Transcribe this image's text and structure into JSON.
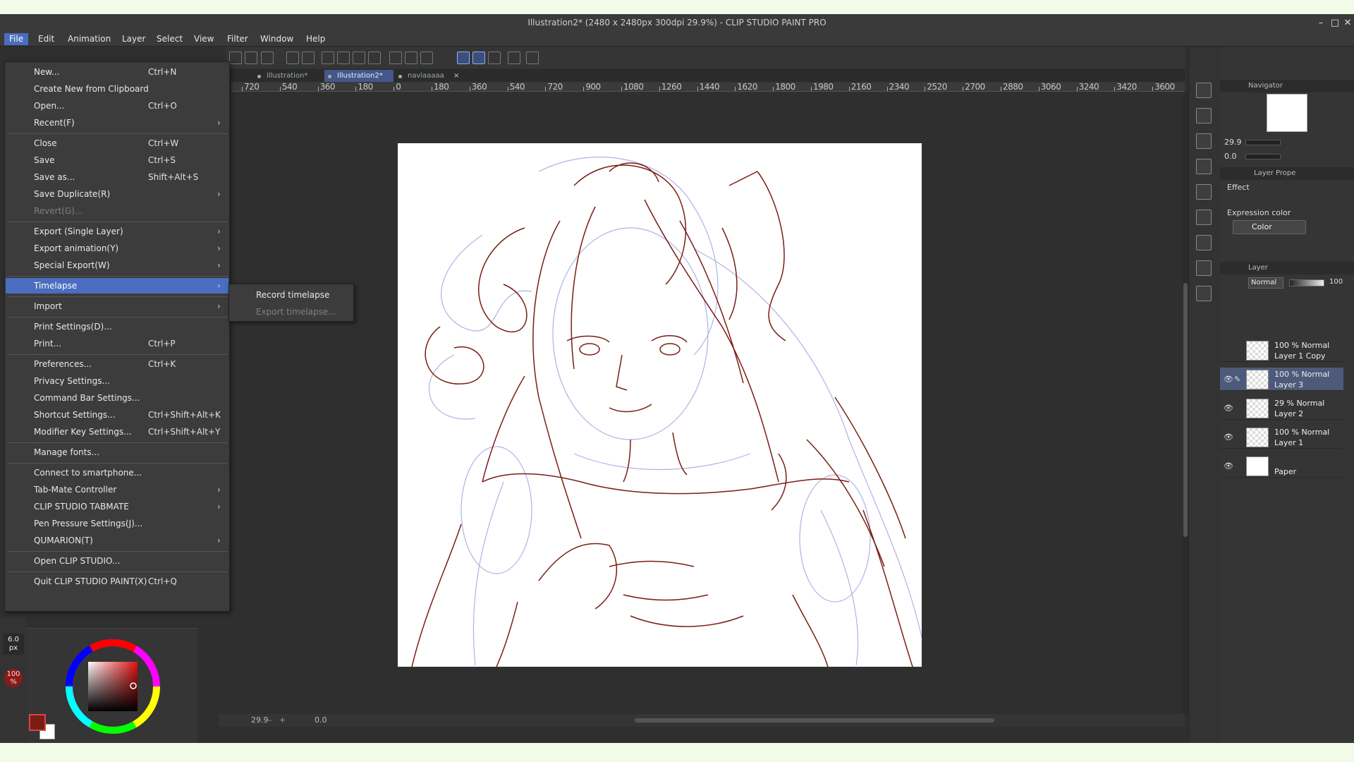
{
  "window": {
    "title": "Illustration2* (2480 x 2480px 300dpi 29.9%) - CLIP STUDIO PAINT PRO",
    "controls": {
      "minimize": "–",
      "maximize": "□",
      "close": "✕"
    }
  },
  "menubar": [
    "File",
    "Edit",
    "Animation",
    "Layer",
    "Select",
    "View",
    "Filter",
    "Window",
    "Help"
  ],
  "tabs": [
    {
      "label": "Illustration*"
    },
    {
      "label": "Illustration2*"
    },
    {
      "label": "naviaaaaa",
      "close": "×"
    }
  ],
  "ruler_labels": [
    "720",
    "540",
    "360",
    "180",
    "0",
    "180",
    "360",
    "540",
    "720",
    "900",
    "1080",
    "1260",
    "1440",
    "1620",
    "1800",
    "1980",
    "2160",
    "2340",
    "2520",
    "2700",
    "2880",
    "3060",
    "3240",
    "3420",
    "3600"
  ],
  "file_menu": [
    {
      "label": "New...",
      "shortcut": "Ctrl+N"
    },
    {
      "label": "Create New from Clipboard",
      "shortcut": ""
    },
    {
      "label": "Open...",
      "shortcut": "Ctrl+O"
    },
    {
      "label": "Recent(F)",
      "submenu": true
    },
    {
      "label": "Close",
      "shortcut": "Ctrl+W"
    },
    {
      "label": "Save",
      "shortcut": "Ctrl+S"
    },
    {
      "label": "Save as...",
      "shortcut": "Shift+Alt+S"
    },
    {
      "label": "Save Duplicate(R)",
      "submenu": true
    },
    {
      "label": "Revert(G)...",
      "disabled": true
    },
    {
      "label": "Export (Single Layer)",
      "submenu": true
    },
    {
      "label": "Export animation(Y)",
      "submenu": true
    },
    {
      "label": "Special Export(W)",
      "submenu": true
    },
    {
      "label": "Timelapse",
      "submenu": true,
      "highlighted": true
    },
    {
      "label": "Import",
      "submenu": true
    },
    {
      "label": "Print Settings(D)...",
      "shortcut": ""
    },
    {
      "label": "Print...",
      "shortcut": "Ctrl+P"
    },
    {
      "label": "Preferences...",
      "shortcut": "Ctrl+K"
    },
    {
      "label": "Privacy Settings...",
      "shortcut": ""
    },
    {
      "label": "Command Bar Settings...",
      "shortcut": ""
    },
    {
      "label": "Shortcut Settings...",
      "shortcut": "Ctrl+Shift+Alt+K"
    },
    {
      "label": "Modifier Key Settings...",
      "shortcut": "Ctrl+Shift+Alt+Y"
    },
    {
      "label": "Manage fonts...",
      "shortcut": ""
    },
    {
      "label": "Connect to smartphone...",
      "shortcut": ""
    },
    {
      "label": "Tab-Mate Controller",
      "submenu": true
    },
    {
      "label": "CLIP STUDIO TABMATE",
      "submenu": true
    },
    {
      "label": "Pen Pressure Settings(J)...",
      "shortcut": ""
    },
    {
      "label": "QUMARION(T)",
      "submenu": true
    },
    {
      "label": "Open CLIP STUDIO...",
      "shortcut": ""
    },
    {
      "label": "Quit CLIP STUDIO PAINT(X)",
      "shortcut": "Ctrl+Q"
    }
  ],
  "timelapse_submenu": [
    {
      "label": "Record timelapse"
    },
    {
      "label": "Export timelapse...",
      "disabled": true
    }
  ],
  "tool": {
    "brush_size": "6.0",
    "brush_unit": "px",
    "opacity": "100",
    "opacity_unit": "%"
  },
  "color": {
    "main_color": "#7a1d14",
    "sub_color": "#ffffff",
    "values": {
      "h": "9",
      "s": "95",
      "v": "45"
    }
  },
  "status": {
    "zoom": "29.9",
    "rotation": "0.0"
  },
  "navigator": {
    "title": "Navigator",
    "zoom": "29.9",
    "angle": "0.0"
  },
  "layer_property": {
    "title": "Layer Prope",
    "effect_label": "Effect",
    "expression_color_label": "Expression color",
    "expression_color_value": "Color"
  },
  "layer_panel": {
    "title": "Layer",
    "blend_mode": "Normal",
    "opacity": "100",
    "layers": [
      {
        "mode": "100 % Normal",
        "name": "Layer 1 Copy",
        "visible": false
      },
      {
        "mode": "100 % Normal",
        "name": "Layer 3",
        "visible": true,
        "selected": true
      },
      {
        "mode": "29 % Normal",
        "name": "Layer 2",
        "visible": true
      },
      {
        "mode": "100 % Normal",
        "name": "Layer 1",
        "visible": true
      },
      {
        "mode": "",
        "name": "Paper",
        "visible": true
      }
    ]
  },
  "icons": {
    "eye": "👁",
    "pen": "✎",
    "submenu_arrow": "›"
  },
  "accent": "#4a6dbf"
}
